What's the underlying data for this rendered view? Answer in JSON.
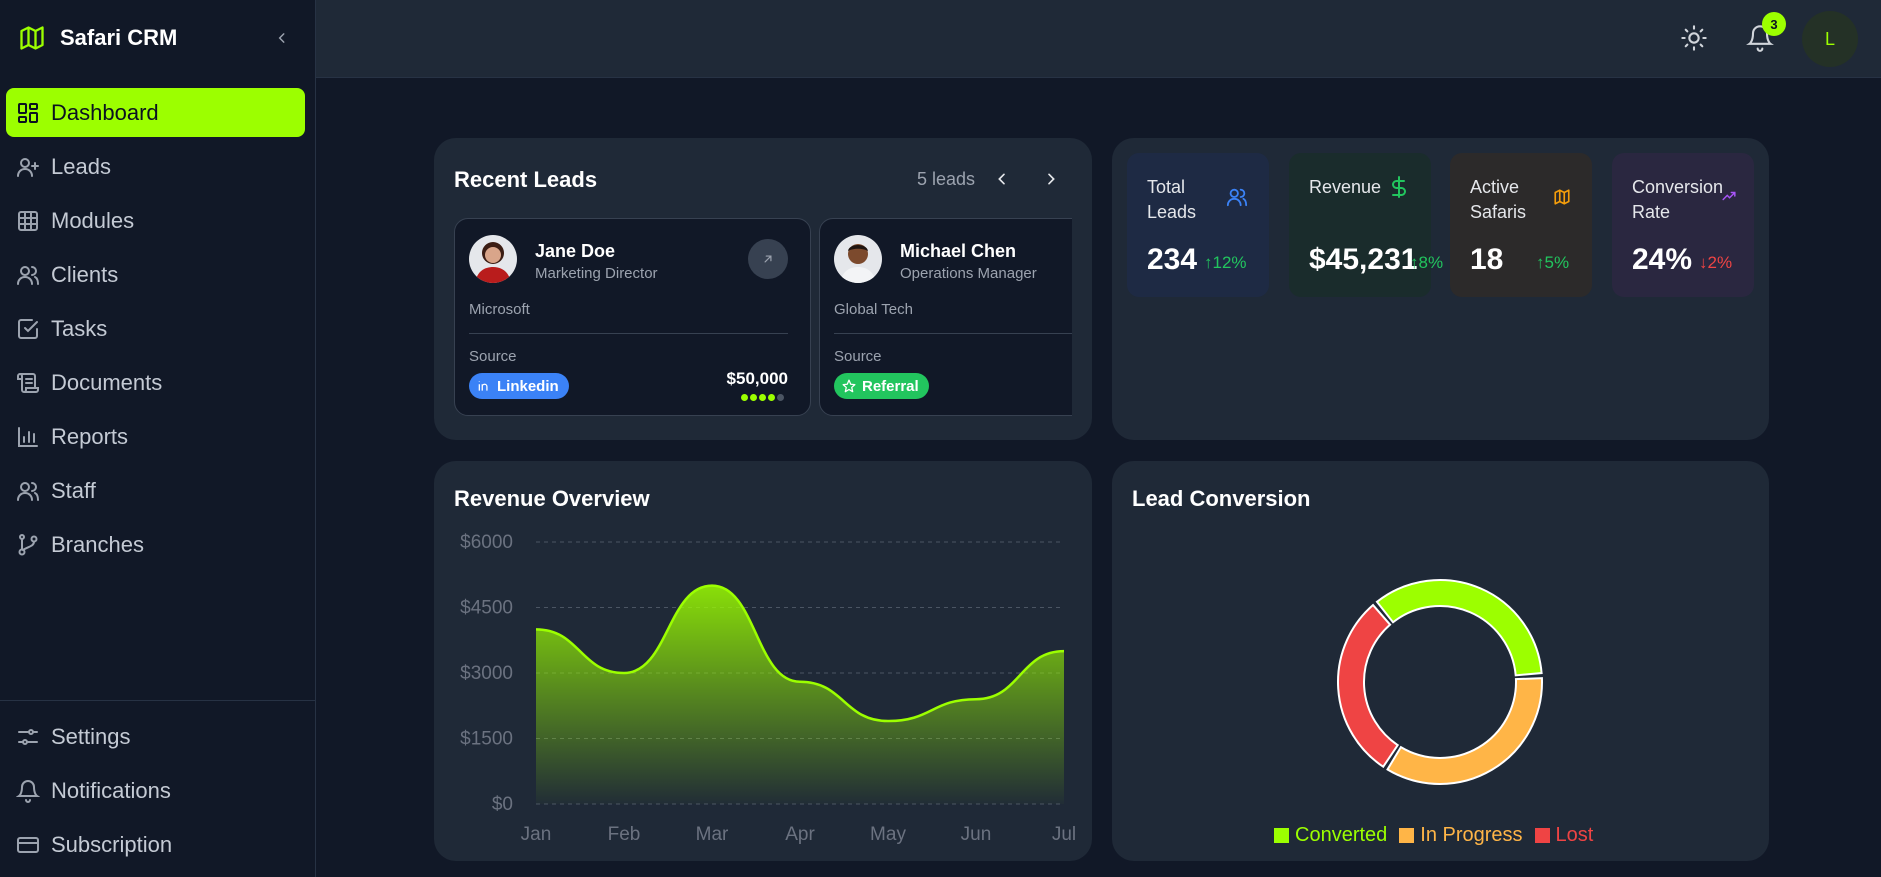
{
  "app": {
    "title": "Safari CRM"
  },
  "sidebar": {
    "items": [
      {
        "label": "Dashboard",
        "icon": "dashboard-icon",
        "active": true
      },
      {
        "label": "Leads",
        "icon": "user-plus-icon",
        "active": false
      },
      {
        "label": "Modules",
        "icon": "grid-icon",
        "active": false
      },
      {
        "label": "Clients",
        "icon": "users-icon",
        "active": false
      },
      {
        "label": "Tasks",
        "icon": "check-square-icon",
        "active": false
      },
      {
        "label": "Documents",
        "icon": "scroll-icon",
        "active": false
      },
      {
        "label": "Reports",
        "icon": "bar-chart-icon",
        "active": false
      },
      {
        "label": "Staff",
        "icon": "users-icon",
        "active": false
      },
      {
        "label": "Branches",
        "icon": "git-branch-icon",
        "active": false
      }
    ],
    "bottom_items": [
      {
        "label": "Settings",
        "icon": "sliders-icon"
      },
      {
        "label": "Notifications",
        "icon": "bell-icon"
      },
      {
        "label": "Subscription",
        "icon": "credit-card-icon"
      }
    ]
  },
  "topbar": {
    "notification_count": "3",
    "avatar_initial": "L"
  },
  "recent_leads": {
    "title": "Recent Leads",
    "count_label": "5 leads",
    "leads": [
      {
        "name": "Jane Doe",
        "role": "Marketing Director",
        "company": "Microsoft",
        "source_label": "Source",
        "source": "Linkedin",
        "value": "$50,000",
        "score": 4,
        "score_max": 5
      },
      {
        "name": "Michael Chen",
        "role": "Operations Manager",
        "company": "Global Tech",
        "source_label": "Source",
        "source": "Referral"
      }
    ]
  },
  "stats": [
    {
      "label_line1": "Total",
      "label_line2": "Leads",
      "value": "234",
      "delta": "12%",
      "direction": "up",
      "icon": "users-icon",
      "color": "#3b82f6"
    },
    {
      "label_line1": "Revenue",
      "label_line2": "",
      "value": "$45,231",
      "delta": "8%",
      "direction": "up",
      "icon": "dollar-icon",
      "color": "#22c55e"
    },
    {
      "label_line1": "Active",
      "label_line2": "Safaris",
      "value": "18",
      "delta": "5%",
      "direction": "up",
      "icon": "map-icon",
      "color": "#f59e0b"
    },
    {
      "label_line1": "Conversion",
      "label_line2": "Rate",
      "value": "24%",
      "delta": "2%",
      "direction": "down",
      "icon": "trending-up-icon",
      "color": "#a855f7"
    }
  ],
  "revenue_overview": {
    "title": "Revenue Overview",
    "chart_data": {
      "type": "area",
      "categories": [
        "Jan",
        "Feb",
        "Mar",
        "Apr",
        "May",
        "Jun",
        "Jul"
      ],
      "values": [
        4000,
        3000,
        5000,
        2800,
        1900,
        2400,
        3500
      ],
      "yticks": [
        "$0",
        "$1500",
        "$3000",
        "$4500",
        "$6000"
      ],
      "ylim": [
        0,
        6000
      ],
      "grid": true,
      "color": "#9cff00"
    }
  },
  "lead_conversion": {
    "title": "Lead Conversion",
    "chart_data": {
      "type": "pie",
      "labels": [
        "Converted",
        "In Progress",
        "Lost"
      ],
      "values": [
        35,
        35,
        30
      ],
      "colors": [
        "#9cff00",
        "#ffb547",
        "#ef4444"
      ],
      "legend": "bottom"
    }
  }
}
